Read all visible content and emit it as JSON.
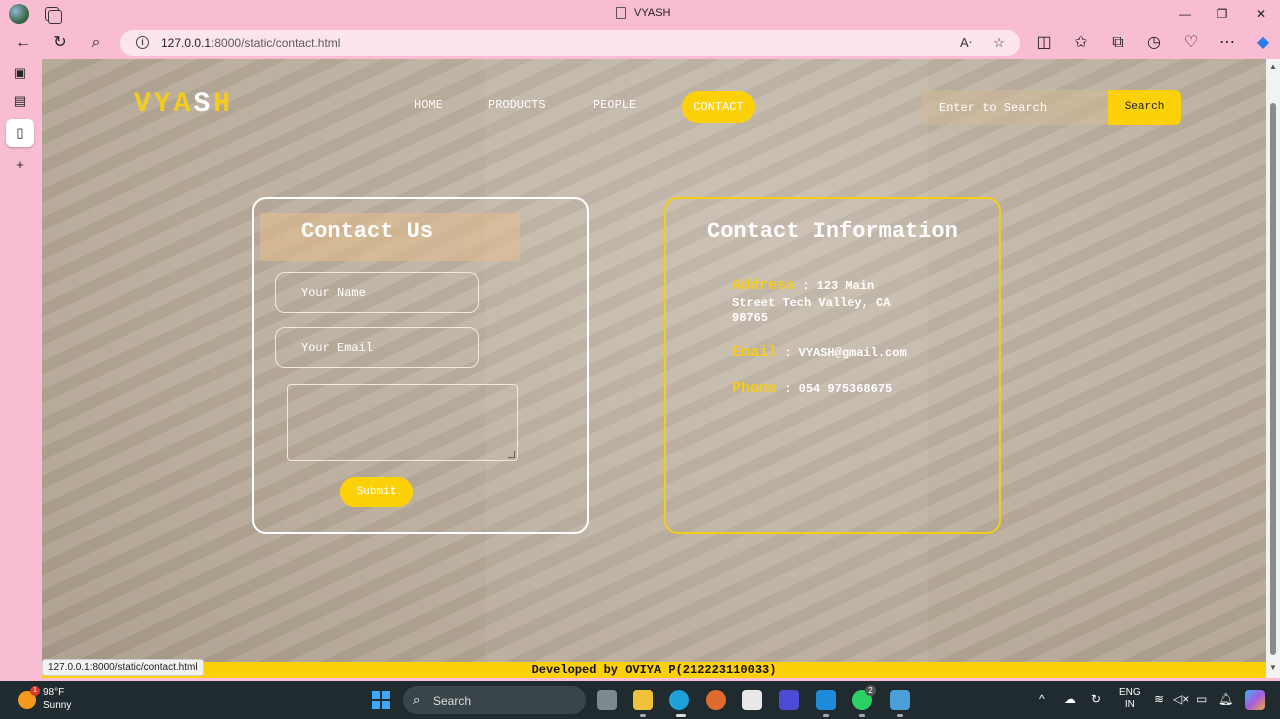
{
  "browser": {
    "tab_title": "VYASH",
    "address_host": "127.0.0.1",
    "address_rest": ":8000/static/contact.html",
    "status_url": "127.0.0.1:8000/static/contact.html"
  },
  "site": {
    "logo": [
      "V",
      "Y",
      "A",
      "S",
      "H"
    ],
    "nav": {
      "home": "HOME",
      "products": "PRODUCTS",
      "people": "PEOPLE",
      "contact": "CONTACT"
    },
    "search": {
      "placeholder": "Enter to Search",
      "button": "Search"
    }
  },
  "contact_form": {
    "title": "Contact Us",
    "name_placeholder": "Your Name",
    "email_placeholder": "Your Email",
    "submit": "Submit"
  },
  "contact_info": {
    "title": "Contact Information",
    "address_label": "Address",
    "address_value": ": 123 Main",
    "address_value_2": "Street Tech Valley, CA",
    "address_value_3": "98765",
    "email_label": "Email",
    "email_value": ": VYASH@gmail.com",
    "phone_label": "Phone",
    "phone_value": ": 054 975368675"
  },
  "footer": {
    "text": "Developed by OVIYA P(212223110033)"
  },
  "taskbar": {
    "weather_temp": "98°F",
    "weather_desc": "Sunny",
    "weather_badge": "1",
    "search": "Search",
    "lang_1": "ENG",
    "lang_2": "IN",
    "whatsapp_badge": "2"
  },
  "colors": {
    "accent": "#fdd10a",
    "logo_yellow": "#f5cc19",
    "chrome_pink": "#f9bdd3"
  }
}
